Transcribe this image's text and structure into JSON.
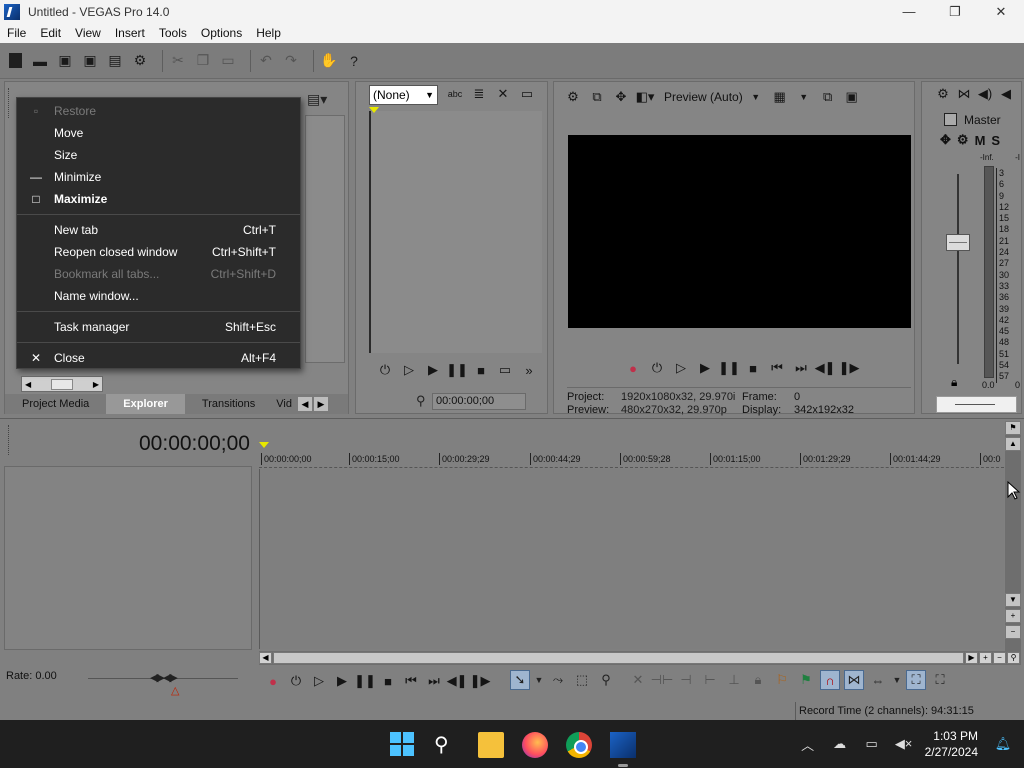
{
  "window": {
    "title": "Untitled - VEGAS Pro 14.0",
    "controls": {
      "minimize": "—",
      "maximize": "❐",
      "close": "✕"
    }
  },
  "menubar": [
    "File",
    "Edit",
    "View",
    "Insert",
    "Tools",
    "Options",
    "Help"
  ],
  "context_menu": {
    "items": [
      {
        "label": "Restore",
        "shortcut": "",
        "glyph": "▫",
        "state": "disabled"
      },
      {
        "label": "Move",
        "shortcut": "",
        "glyph": "",
        "state": "normal"
      },
      {
        "label": "Size",
        "shortcut": "",
        "glyph": "",
        "state": "normal"
      },
      {
        "label": "Minimize",
        "shortcut": "",
        "glyph": "—",
        "state": "normal"
      },
      {
        "label": "Maximize",
        "shortcut": "",
        "glyph": "□",
        "state": "bold"
      },
      {
        "label": "New tab",
        "shortcut": "Ctrl+T",
        "glyph": "",
        "state": "normal"
      },
      {
        "label": "Reopen closed window",
        "shortcut": "Ctrl+Shift+T",
        "glyph": "",
        "state": "normal"
      },
      {
        "label": "Bookmark all tabs...",
        "shortcut": "Ctrl+Shift+D",
        "glyph": "",
        "state": "disabled"
      },
      {
        "label": "Name window...",
        "shortcut": "",
        "glyph": "",
        "state": "normal"
      },
      {
        "label": "Task manager",
        "shortcut": "Shift+Esc",
        "glyph": "",
        "state": "normal"
      },
      {
        "label": "Close",
        "shortcut": "Alt+F4",
        "glyph": "✕",
        "state": "normal"
      }
    ]
  },
  "left_panel": {
    "tabs": [
      "Project Media",
      "Explorer",
      "Transitions",
      "Vid"
    ],
    "active_tab": "Explorer"
  },
  "trimmer": {
    "select_value": "(None)",
    "timecode": "00:00:00;00"
  },
  "preview": {
    "mode_label": "Preview (Auto)",
    "info": {
      "project_label": "Project:",
      "project_value": "1920x1080x32, 29.970i",
      "frame_label": "Frame:",
      "frame_value": "0",
      "preview_label": "Preview:",
      "preview_value": "480x270x32, 29.970p",
      "display_label": "Display:",
      "display_value": "342x192x32"
    }
  },
  "master": {
    "label": "Master",
    "buttons": [
      "M",
      "S"
    ],
    "inf_left": "-Inf.",
    "inf_right": "-I",
    "scale": [
      "3",
      "6",
      "9",
      "12",
      "15",
      "18",
      "21",
      "24",
      "27",
      "30",
      "33",
      "36",
      "39",
      "42",
      "45",
      "48",
      "51",
      "54",
      "57"
    ],
    "bottom_left": "0.0",
    "bottom_right": "0"
  },
  "timeline": {
    "timecode": "00:00:00;00",
    "ruler": [
      "00:00:00;00",
      "00:00:15;00",
      "00:00:29;29",
      "00:00:44;29",
      "00:00:59;28",
      "00:01:15;00",
      "00:01:29;29",
      "00:01:44;29",
      "00:0"
    ],
    "rate_label": "Rate: 0.00"
  },
  "status": {
    "record_time": "Record Time (2 channels): 94:31:15"
  },
  "taskbar": {
    "time": "1:03 PM",
    "date": "2/27/2024"
  }
}
